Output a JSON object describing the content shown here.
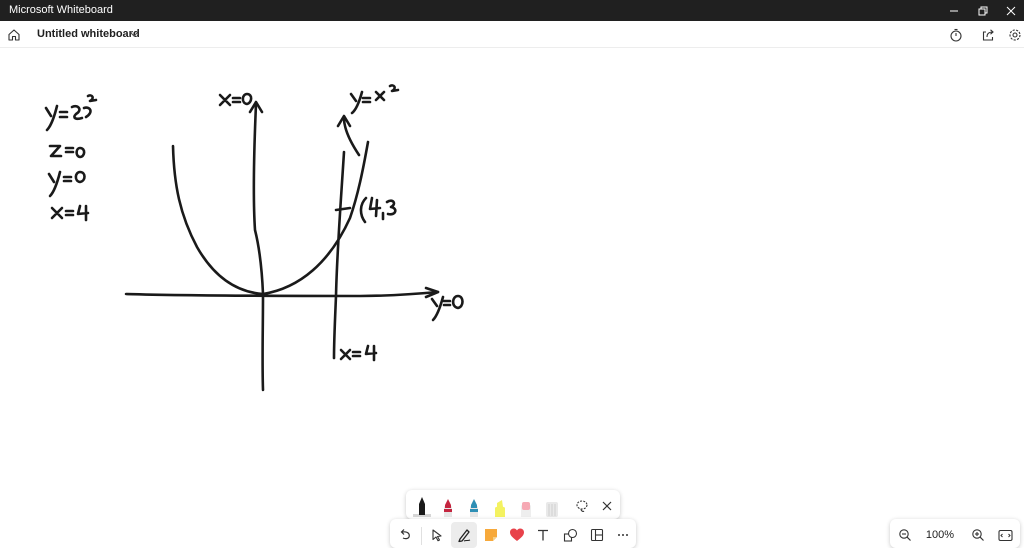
{
  "titlebar": {
    "app_name": "Microsoft Whiteboard"
  },
  "header": {
    "board_title": "Untitled whiteboard"
  },
  "zoom": {
    "level": "100%"
  },
  "colors": {
    "titlebar_bg": "#202020",
    "ink": "#1a1a1a",
    "pen_black": "#1a1a1a",
    "pen_red": "#c4253f",
    "pen_blue": "#2e8fb5",
    "highlighter_yellow": "#f4f261",
    "highlighter_pink": "#f6a9b4",
    "sticky_note": "#f7a93b",
    "reaction_heart": "#e8424a"
  },
  "icons": [
    "minimize-icon",
    "restore-icon",
    "close-icon",
    "home-icon",
    "chevron-down-icon",
    "timer-icon",
    "share-icon",
    "settings-icon",
    "undo-icon",
    "select-icon",
    "inking-icon",
    "sticky-note-icon",
    "heart-icon",
    "text-icon",
    "shapes-icon",
    "templates-icon",
    "more-icon",
    "lasso-icon",
    "zoom-out-icon",
    "zoom-in-icon",
    "fit-to-screen-icon"
  ]
}
